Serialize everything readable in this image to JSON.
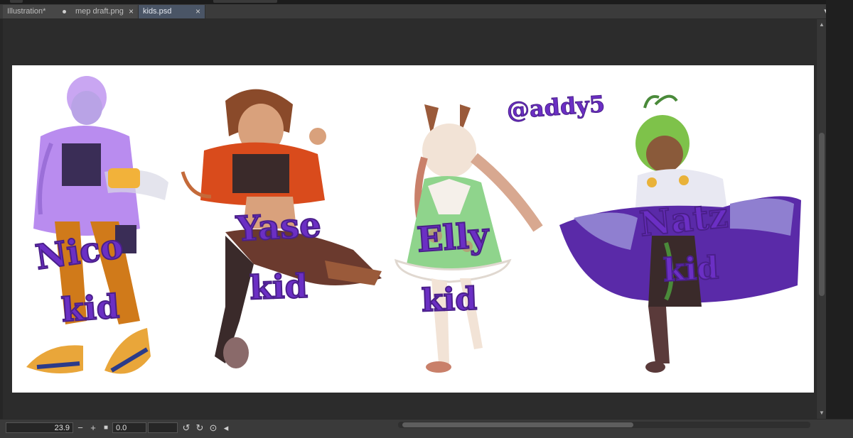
{
  "tabs": [
    {
      "label": "Illustration*",
      "control": "dot",
      "active": false
    },
    {
      "label": "mep draft.png",
      "control": "×",
      "active": false
    },
    {
      "label": "kids.psd",
      "control": "×",
      "active": true
    }
  ],
  "tab_overflow_icon": "chevron-down-icon",
  "artwork": {
    "signature": "@addy5",
    "characters": [
      {
        "name": "Nico",
        "suffix": "kid",
        "main_color": "#b98cef"
      },
      {
        "name": "Yase",
        "suffix": "kid",
        "main_color": "#d94b1c"
      },
      {
        "name": "Elly",
        "suffix": "kid",
        "main_color": "#8fd48c"
      },
      {
        "name": "Natz",
        "suffix": "kid",
        "main_color": "#5a2aa8"
      }
    ],
    "label_color": "#6b2fc4"
  },
  "status": {
    "zoom": "23.9",
    "zoom_out": "−",
    "zoom_in": "+",
    "rotation": "0.0"
  },
  "colors": {
    "accent": "#4a5566",
    "workspace": "#2c2c2c"
  }
}
